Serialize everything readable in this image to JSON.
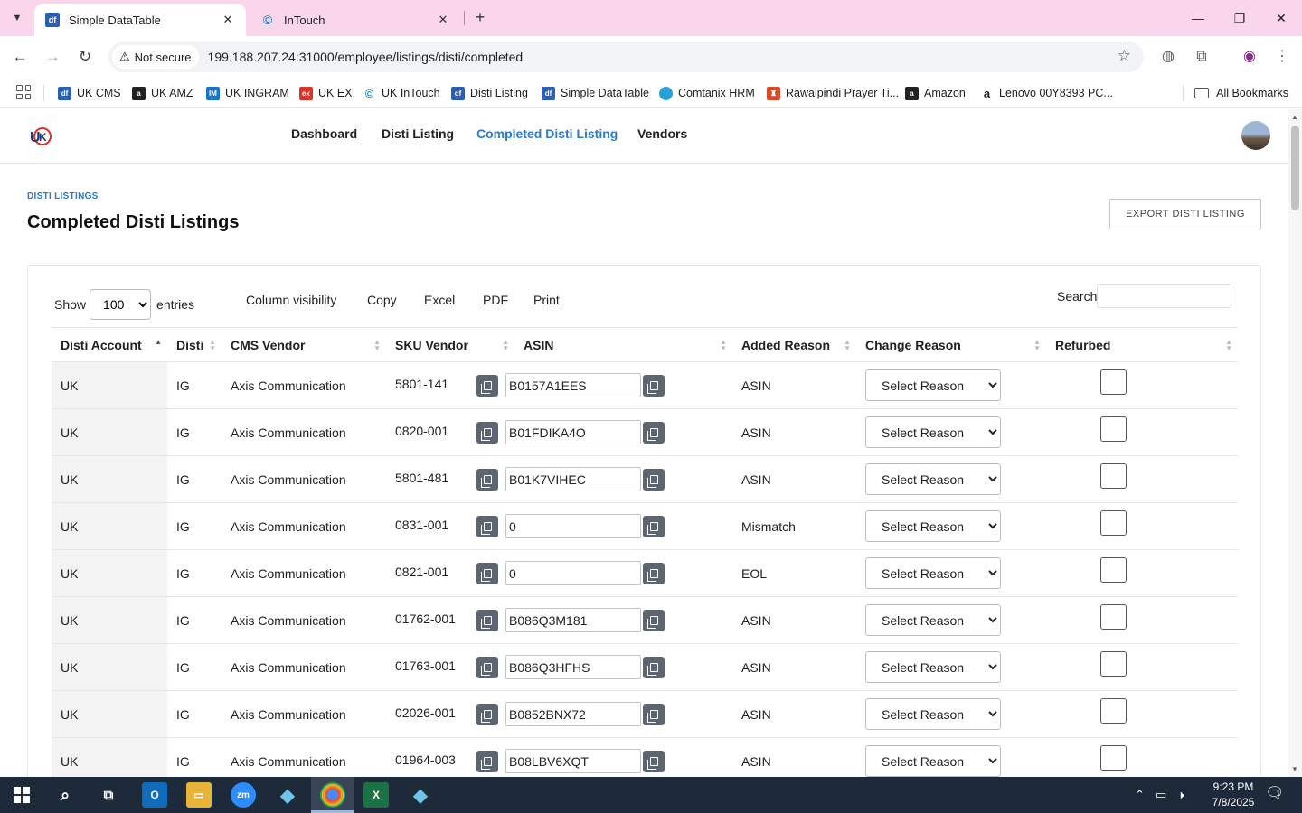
{
  "browser": {
    "tabs": [
      {
        "title": "Simple DataTable",
        "favicon": "df"
      },
      {
        "title": "InTouch",
        "favicon": "intouch-icon"
      }
    ],
    "security_label": "Not secure",
    "url": "199.188.207.24:31000/employee/listings/disti/completed",
    "bookmarks": [
      {
        "label": "UK CMS",
        "favicon": "df",
        "color": "#2b5fb3"
      },
      {
        "label": "UK AMZ",
        "favicon": "a",
        "color": "#222222"
      },
      {
        "label": "UK INGRAM",
        "favicon": "IM",
        "color": "#1a73c9"
      },
      {
        "label": "UK EX",
        "favicon": "ex",
        "color": "#d9342b"
      },
      {
        "label": "UK InTouch",
        "favicon": "C",
        "color": "#1b8fd6"
      },
      {
        "label": "Disti Listing",
        "favicon": "df",
        "color": "#2b5fb3"
      },
      {
        "label": "Simple DataTable",
        "favicon": "df",
        "color": "#2b5fb3"
      },
      {
        "label": "Comtanix HRM",
        "favicon": "c",
        "color": "#2a9fd6"
      },
      {
        "label": "Rawalpindi Prayer Ti...",
        "favicon": "mosque",
        "color": "#d94a2b"
      },
      {
        "label": "Amazon",
        "favicon": "a",
        "color": "#222222"
      },
      {
        "label": "Lenovo 00Y8393 PC...",
        "favicon": "a",
        "color": "#ffffff"
      }
    ],
    "all_bookmarks": "All Bookmarks"
  },
  "nav": {
    "links": [
      "Dashboard",
      "Disti Listing",
      "Completed Disti Listing",
      "Vendors"
    ],
    "active": "Completed Disti Listing",
    "accent": "#2a7bc8"
  },
  "page": {
    "breadcrumb": "DISTI LISTINGS",
    "title": "Completed Disti Listings",
    "export_label": "EXPORT DISTI LISTING"
  },
  "datatable": {
    "show_label": "Show",
    "entries_label": "entries",
    "page_length": "100",
    "buttons": [
      "Column visibility",
      "Copy",
      "Excel",
      "PDF",
      "Print"
    ],
    "search_label": "Search",
    "columns": [
      "Disti Account",
      "Disti",
      "CMS Vendor",
      "SKU Vendor",
      "ASIN",
      "Added Reason",
      "Change Reason",
      "Refurbed"
    ],
    "sorted_column": "Disti Account",
    "reason_placeholder": "Select Reason",
    "rows": [
      {
        "account": "UK",
        "disti": "IG",
        "vendor": "Axis Communication",
        "sku": "5801-141",
        "asin": "B0157A1EES",
        "added_reason": "ASIN",
        "refurbed": false
      },
      {
        "account": "UK",
        "disti": "IG",
        "vendor": "Axis Communication",
        "sku": "0820-001",
        "asin": "B01FDIKA4O",
        "added_reason": "ASIN",
        "refurbed": false
      },
      {
        "account": "UK",
        "disti": "IG",
        "vendor": "Axis Communication",
        "sku": "5801-481",
        "asin": "B01K7VIHEC",
        "added_reason": "ASIN",
        "refurbed": false
      },
      {
        "account": "UK",
        "disti": "IG",
        "vendor": "Axis Communication",
        "sku": "0831-001",
        "asin": "0",
        "added_reason": "Mismatch",
        "refurbed": false
      },
      {
        "account": "UK",
        "disti": "IG",
        "vendor": "Axis Communication",
        "sku": "0821-001",
        "asin": "0",
        "added_reason": "EOL",
        "refurbed": false
      },
      {
        "account": "UK",
        "disti": "IG",
        "vendor": "Axis Communication",
        "sku": "01762-001",
        "asin": "B086Q3M181",
        "added_reason": "ASIN",
        "refurbed": false
      },
      {
        "account": "UK",
        "disti": "IG",
        "vendor": "Axis Communication",
        "sku": "01763-001",
        "asin": "B086Q3HFHS",
        "added_reason": "ASIN",
        "refurbed": false
      },
      {
        "account": "UK",
        "disti": "IG",
        "vendor": "Axis Communication",
        "sku": "02026-001",
        "asin": "B0852BNX72",
        "added_reason": "ASIN",
        "refurbed": false
      },
      {
        "account": "UK",
        "disti": "IG",
        "vendor": "Axis Communication",
        "sku": "01964-003",
        "asin": "B08LBV6XQT",
        "added_reason": "ASIN",
        "refurbed": false
      }
    ]
  },
  "taskbar": {
    "time": "9:23 PM",
    "date": "7/8/2025",
    "notification_count": "1"
  }
}
